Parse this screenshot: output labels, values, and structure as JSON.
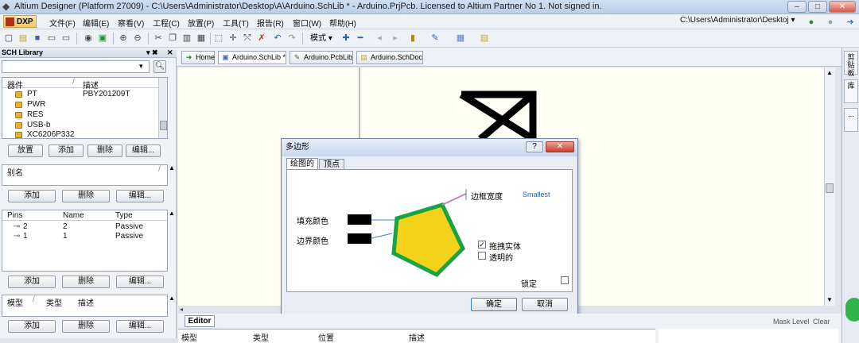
{
  "titlebar": {
    "title": "Altium Designer (Platform 27009) - C:\\Users\\Administrator\\Desktop\\A\\Arduino.SchLib * - Arduino.PrjPcb. Licensed to Altium Partner No 1. Not signed in.",
    "minimize": "–",
    "maximize": "□",
    "close": "✕"
  },
  "menu": {
    "dxp": "DXP",
    "items": [
      "文件(F)",
      "编辑(E)",
      "察看(V)",
      "工程(C)",
      "放置(P)",
      "工具(T)",
      "报告(R)",
      "窗口(W)",
      "帮助(H)"
    ],
    "path": "C:\\Users\\Administrator\\Desktoj"
  },
  "toolbar": {
    "mode_label": "模式"
  },
  "library_panel": {
    "title": "SCH Library",
    "components": {
      "col_name": "器件",
      "col_desc": "描述",
      "rows": [
        {
          "name": "PT",
          "desc": "PBY201209T"
        },
        {
          "name": "PWR",
          "desc": ""
        },
        {
          "name": "RES",
          "desc": ""
        },
        {
          "name": "USB-b",
          "desc": ""
        },
        {
          "name": "XC6206P332",
          "desc": ""
        }
      ],
      "buttons": [
        "放置",
        "添加",
        "删除",
        "编辑..."
      ]
    },
    "aliases": {
      "label": "别名",
      "buttons": [
        "添加",
        "删除",
        "编辑..."
      ]
    },
    "pins": {
      "col_pins": "Pins",
      "col_name": "Name",
      "col_type": "Type",
      "rows": [
        {
          "pin": "2",
          "name": "2",
          "type": "Passive"
        },
        {
          "pin": "1",
          "name": "1",
          "type": "Passive"
        }
      ],
      "buttons": [
        "添加",
        "删除",
        "编辑..."
      ]
    },
    "models": {
      "col_model": "模型",
      "col_type": "类型",
      "col_desc": "描述",
      "buttons": [
        "添加",
        "删除",
        "编辑..."
      ]
    }
  },
  "doc_tabs": [
    {
      "label": "Home"
    },
    {
      "label": "Arduino.SchLib *"
    },
    {
      "label": "Arduino.PcbLib"
    },
    {
      "label": "Arduino.SchDoc"
    }
  ],
  "side_tabs": [
    "剪贴板",
    "库",
    "..."
  ],
  "dialog": {
    "title": "多边形",
    "help": "?",
    "close": "✕",
    "tabs": [
      "绘图的",
      "顶点"
    ],
    "fill_color_label": "填充颜色",
    "border_color_label": "边界颜色",
    "border_width_label": "边框宽度",
    "border_width_value": "Smallest",
    "draw_solid_label": "拖拽实体",
    "draw_solid_checked": true,
    "transparent_label": "透明的",
    "transparent_checked": false,
    "lock_label": "锁定",
    "lock_checked": false,
    "ok": "确定",
    "cancel": "取消",
    "fill_color": "#f4d21a",
    "border_color": "#1aa344"
  },
  "editor": {
    "tab": "Editor",
    "columns": [
      "模型",
      "类型",
      "位置",
      "描述"
    ]
  },
  "status": {
    "mask_level": "Mask Level",
    "clear": "Clear"
  }
}
